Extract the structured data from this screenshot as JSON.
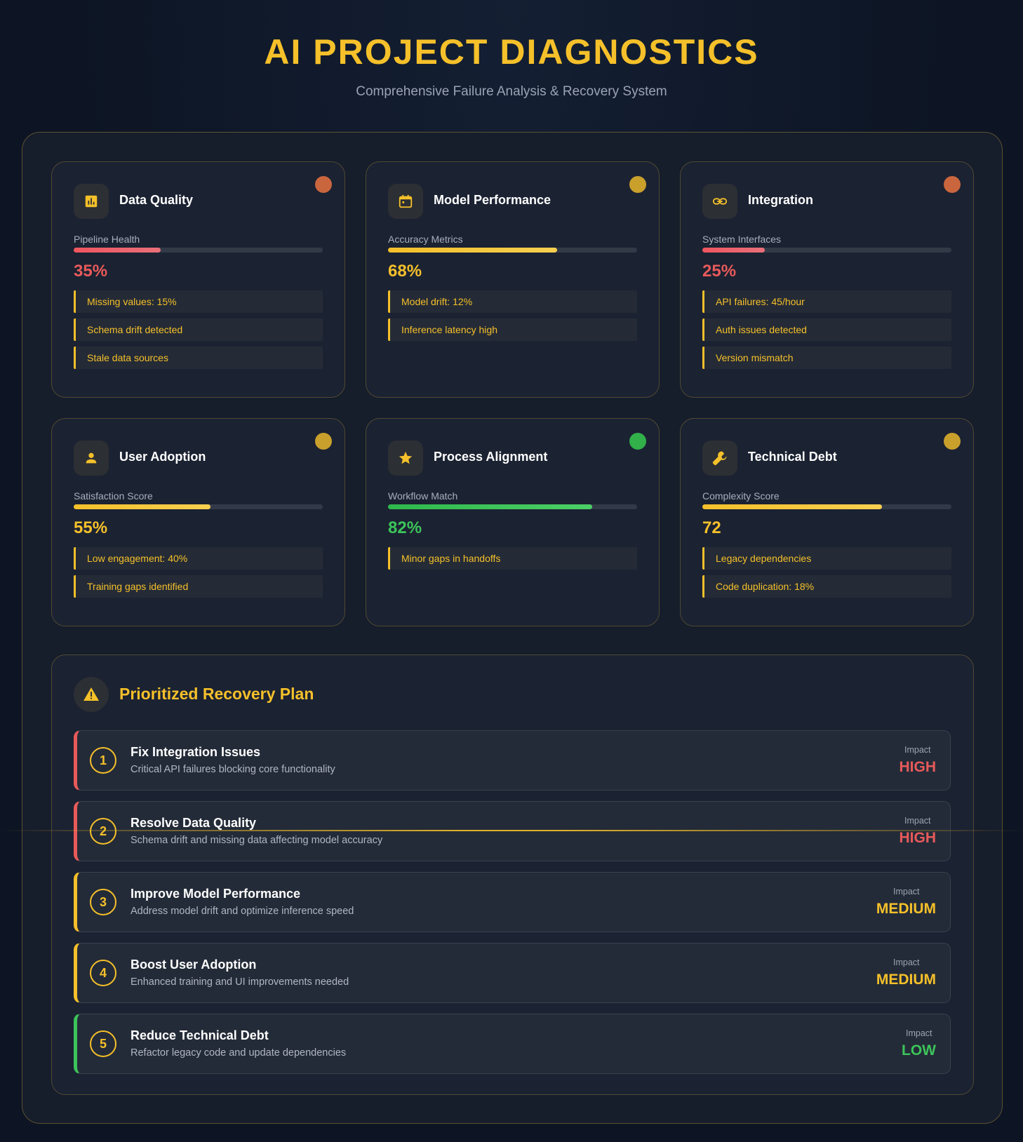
{
  "header": {
    "title": "AI PROJECT DIAGNOSTICS",
    "subtitle": "Comprehensive Failure Analysis & Recovery System"
  },
  "colors": {
    "accent": "#f5c02a",
    "critical": "#e85a5a",
    "warning": "#f5c02a",
    "good": "#3cc45a",
    "status_red": "#c9663e",
    "status_yellow": "#c9a02c",
    "status_green": "#32b04a"
  },
  "cards": [
    {
      "title": "Data Quality",
      "icon": "bar-chart-icon",
      "status": "critical",
      "metric_label": "Pipeline Health",
      "value": "35%",
      "progress": 0.35,
      "issues": [
        "Missing values: 15%",
        "Schema drift detected",
        "Stale data sources"
      ]
    },
    {
      "title": "Model Performance",
      "icon": "calendar-icon",
      "status": "warning",
      "metric_label": "Accuracy Metrics",
      "value": "68%",
      "progress": 0.68,
      "issues": [
        "Model drift: 12%",
        "Inference latency high"
      ]
    },
    {
      "title": "Integration",
      "icon": "link-icon",
      "status": "critical",
      "metric_label": "System Interfaces",
      "value": "25%",
      "progress": 0.25,
      "issues": [
        "API failures: 45/hour",
        "Auth issues detected",
        "Version mismatch"
      ]
    },
    {
      "title": "User Adoption",
      "icon": "user-icon",
      "status": "warning",
      "metric_label": "Satisfaction Score",
      "value": "55%",
      "progress": 0.55,
      "issues": [
        "Low engagement: 40%",
        "Training gaps identified"
      ]
    },
    {
      "title": "Process Alignment",
      "icon": "star-icon",
      "status": "good",
      "metric_label": "Workflow Match",
      "value": "82%",
      "progress": 0.82,
      "issues": [
        "Minor gaps in handoffs"
      ]
    },
    {
      "title": "Technical Debt",
      "icon": "wrench-icon",
      "status": "warning",
      "metric_label": "Complexity Score",
      "value": "72",
      "progress": 0.72,
      "issues": [
        "Legacy dependencies",
        "Code duplication: 18%"
      ]
    }
  ],
  "plan": {
    "title": "Prioritized Recovery Plan",
    "impact_label": "Impact",
    "items": [
      {
        "num": "1",
        "title": "Fix Integration Issues",
        "desc": "Critical API failures blocking core functionality",
        "impact": "HIGH",
        "level": "critical"
      },
      {
        "num": "2",
        "title": "Resolve Data Quality",
        "desc": "Schema drift and missing data affecting model accuracy",
        "impact": "HIGH",
        "level": "critical"
      },
      {
        "num": "3",
        "title": "Improve Model Performance",
        "desc": "Address model drift and optimize inference speed",
        "impact": "MEDIUM",
        "level": "warning"
      },
      {
        "num": "4",
        "title": "Boost User Adoption",
        "desc": "Enhanced training and UI improvements needed",
        "impact": "MEDIUM",
        "level": "warning"
      },
      {
        "num": "5",
        "title": "Reduce Technical Debt",
        "desc": "Refactor legacy code and update dependencies",
        "impact": "LOW",
        "level": "good"
      }
    ]
  }
}
